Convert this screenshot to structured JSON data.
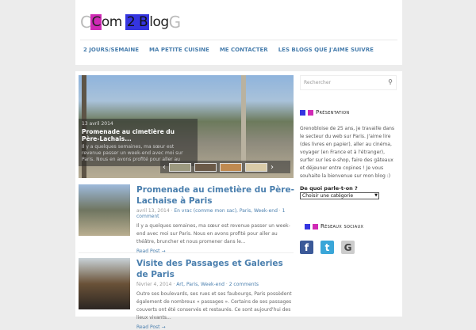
{
  "logo": {
    "text": "Com 2 Blog",
    "parts": [
      "C",
      "C",
      "om",
      "2 B",
      "l",
      "og",
      "G"
    ]
  },
  "nav": [
    "2 JOURS/SEMAINE",
    "MA PETITE CUISINE",
    "ME CONTACTER",
    "LES BLOGS QUE J'AIME SUIVRE"
  ],
  "slider": {
    "date": "13 avril 2014",
    "title": "Promenade au cimetière du Père-Lachais...",
    "excerpt": "Il y a quelques semaines, ma sœur est revenue passer un week-end avec moi sur Paris. Nous en avons profité pour aller au théâtre, brunch et nous..."
  },
  "posts": [
    {
      "title": "Promenade au cimetière du Père-Lachaise à Paris",
      "date": "avril 13, 2014",
      "cats": "En vrac (comme mon sac), Paris, Week-end",
      "comments": "1 comment",
      "excerpt": "Il y a quelques semaines, ma sœur est revenue passer un week-end avec moi sur Paris. Nous en avons profité pour aller au théâtre, bruncher et nous promener dans le...",
      "more": "Read Post →"
    },
    {
      "title": "Visite des Passages et Galeries de Paris",
      "date": "février 4, 2014",
      "cats": "Art, Paris, Week-end",
      "comments": "2 comments",
      "excerpt": "Outre ses boulevards, ses rues et ses faubourgs, Paris possèdent également de nombreux « passages ». Certains de ses passages couverts ont été conservés et restaurés. Ce sont aujourd'hui des lieux vivants...",
      "more": "Read Post →"
    }
  ],
  "sidebar": {
    "search_placeholder": "Rechercher",
    "presentation_title": "Présentation",
    "about": "Grenobloise de 25 ans, je travaille dans le secteur du web sur Paris. J'aime lire (des livres en papier), aller au cinéma, voyager (en France et à l'étranger), surfer sur les e-shop, faire des gâteaux et déjeuner entre copines ! Je vous souhaite la bienvenue sur mon blog :)",
    "cat_label": "De quoi parle-t-on ?",
    "cat_select": "Choisir une catégorie",
    "social_title": "Réseaux sociaux",
    "social": [
      "f",
      "t",
      "G"
    ]
  },
  "colors": {
    "accent": "#4a7fae",
    "pink": "#d02ab5",
    "blue": "#3535e0"
  }
}
